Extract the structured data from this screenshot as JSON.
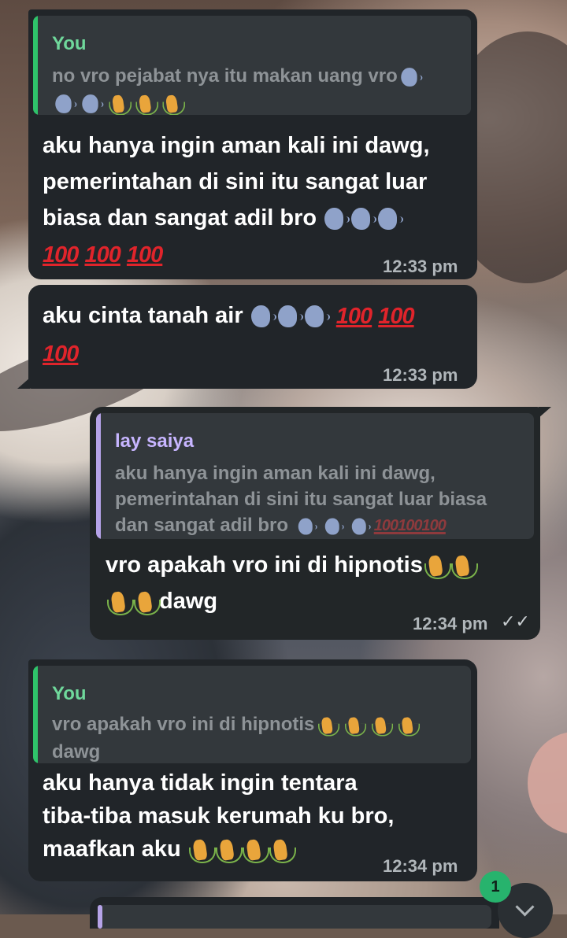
{
  "colors": {
    "accent_you": "#2fc36a",
    "name_you": "#6fd89b",
    "accent_other": "#b6a3e8",
    "name_other": "#c7b5ff",
    "emoji_100": "#e0242b"
  },
  "messages": [
    {
      "reply": {
        "name": "You",
        "text": "no vro pejabat nya itu makan uang vro",
        "emoji_tail": [
          "speaking-head",
          "speaking-head",
          "speaking-head",
          "pray-hands",
          "pray-hands",
          "pray-hands"
        ]
      },
      "lines": [
        "aku hanya ingin aman kali ini dawg,",
        "pemerintahan di sini itu sangat luar",
        "biasa dan sangat adil bro"
      ],
      "hundred": "100",
      "time": "12:33 pm"
    },
    {
      "text": "aku cinta tanah air",
      "hundred": "100",
      "time": "12:33 pm"
    },
    {
      "reply": {
        "name": "lay saiya",
        "lines": [
          "aku hanya ingin aman kali ini dawg,",
          "pemerintahan di sini itu sangat luar biasa",
          "dan sangat adil bro"
        ]
      },
      "text": "vro apakah vro ini di hipnotis",
      "tail": "dawg",
      "time": "12:34 pm",
      "status": "read"
    },
    {
      "reply": {
        "name": "You",
        "text": "vro apakah vro ini di hipnotis",
        "line2": "dawg"
      },
      "lines": [
        "aku hanya tidak ingin tentara",
        "tiba-tiba masuk kerumah ku bro,",
        "maafkan aku"
      ],
      "time": "12:34 pm"
    }
  ],
  "unread_count": "1",
  "scroll_button": {
    "icon": "chevron-down-icon"
  }
}
